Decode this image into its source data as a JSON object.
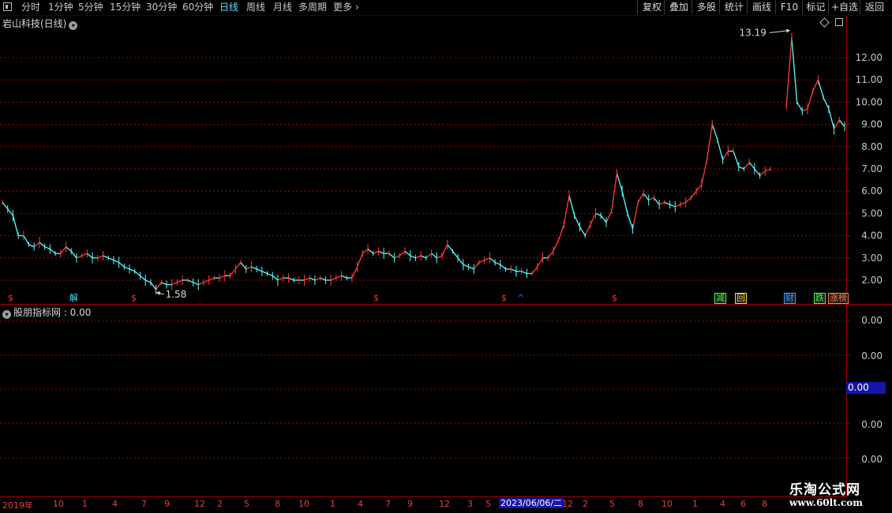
{
  "toolbar": {
    "tabs": [
      {
        "label": "分时",
        "active": false
      },
      {
        "label": "1分钟",
        "active": false
      },
      {
        "label": "5分钟",
        "active": false
      },
      {
        "label": "15分钟",
        "active": false
      },
      {
        "label": "30分钟",
        "active": false
      },
      {
        "label": "60分钟",
        "active": false
      },
      {
        "label": "日线",
        "active": true
      },
      {
        "label": "周线",
        "active": false
      },
      {
        "label": "月线",
        "active": false
      },
      {
        "label": "多周期",
        "active": false
      },
      {
        "label": "更多",
        "active": false
      }
    ],
    "more_arrow": "›",
    "right_buttons": [
      "复权",
      "叠加",
      "多股",
      "统计",
      "画线",
      "F10",
      "标记",
      "+自选",
      "返回"
    ]
  },
  "main_panel": {
    "title": "岩山科技(日线)"
  },
  "indicator_panel": {
    "title": "股朋指标网 : 0.00",
    "ticks": [
      "0.00",
      "0.00",
      "0.00",
      "0.00",
      "0.00"
    ],
    "current_value": "0.00"
  },
  "event_markers": [
    {
      "label": "$",
      "color": "#ff3030"
    },
    {
      "label": "解",
      "color": "#40e0ff"
    },
    {
      "label": "$",
      "color": "#ff3030"
    },
    {
      "label": "$",
      "color": "#ff3030"
    },
    {
      "label": "$",
      "color": "#ff3030"
    },
    {
      "label": "^",
      "color": "#4060ff"
    },
    {
      "label": "$",
      "color": "#ff3030"
    },
    {
      "label": "减",
      "color": "#40ff40"
    },
    {
      "label": "回",
      "color": "#ffd040"
    },
    {
      "label": "财",
      "color": "#40a0ff"
    },
    {
      "label": "跌",
      "color": "#40ff40"
    },
    {
      "label": "涨榜",
      "color": "#ff8040"
    }
  ],
  "x_axis": {
    "labels": [
      "2019年",
      "10",
      "1",
      "4",
      "7",
      "9",
      "12",
      "2",
      "5",
      "8",
      "10",
      "1",
      "4",
      "7",
      "9",
      "12",
      "3",
      "5",
      "12",
      "2",
      "5",
      "8",
      "10",
      "1",
      "4",
      "6",
      "8"
    ],
    "current_date": "2023/06/06/二"
  },
  "watermark": {
    "site_name": "乐淘公式网",
    "url": "www.60lt.com"
  },
  "colors": {
    "up": "#ff3c3c",
    "down": "#54ffff",
    "grid": "#aa0000",
    "axis_text": "#c8c8c8"
  },
  "chart_data": {
    "type": "line",
    "title": "岩山科技(日线)",
    "xlabel": "",
    "ylabel": "",
    "ylim": [
      1.3,
      13.5
    ],
    "y_ticks": [
      2.0,
      3.0,
      4.0,
      5.0,
      6.0,
      7.0,
      8.0,
      9.0,
      10.0,
      11.0,
      12.0
    ],
    "y_tick_labels": [
      "2.00",
      "3.00",
      "4.00",
      "5.00",
      "6.00",
      "7.00",
      "8.00",
      "9.00",
      "10.00",
      "11.00",
      "12.00"
    ],
    "annotations": [
      {
        "label": "13.19",
        "value": 13.19
      },
      {
        "label": "1.58",
        "value": 1.58
      }
    ],
    "series": [
      {
        "values": [
          5.5,
          5.2,
          4.9,
          4.0,
          4.0,
          3.6,
          3.5,
          3.7,
          3.5,
          3.4,
          3.2,
          3.2,
          3.5,
          3.3,
          3.0,
          3.1,
          3.2,
          3.0,
          3.0,
          3.1,
          3.0,
          2.9,
          2.8,
          2.6,
          2.5,
          2.4,
          2.2,
          2.0,
          1.9,
          1.58,
          1.9,
          1.8,
          1.8,
          1.9,
          2.0,
          2.0,
          1.9,
          1.8,
          1.9,
          2.0,
          2.1,
          2.1,
          2.2,
          2.2,
          2.5,
          2.8,
          2.5,
          2.6,
          2.5,
          2.4,
          2.3,
          2.2,
          2.0,
          2.1,
          2.1,
          2.0,
          2.0,
          2.0,
          2.1,
          2.0,
          2.1,
          2.0,
          2.0,
          2.1,
          2.2,
          2.1,
          2.1,
          2.6,
          3.2,
          3.4,
          3.2,
          3.3,
          3.2,
          3.2,
          3.0,
          3.1,
          3.3,
          3.1,
          3.0,
          3.1,
          3.0,
          3.2,
          3.0,
          3.1,
          3.6,
          3.3,
          3.0,
          2.7,
          2.6,
          2.5,
          2.8,
          2.9,
          3.0,
          2.8,
          2.7,
          2.5,
          2.5,
          2.4,
          2.4,
          2.3,
          2.3,
          2.6,
          3.0,
          3.0,
          3.3,
          3.8,
          4.5,
          5.8,
          4.9,
          4.4,
          4.0,
          4.5,
          5.0,
          4.9,
          4.6,
          5.1,
          6.8,
          6.0,
          5.0,
          4.3,
          5.5,
          5.9,
          5.6,
          5.7,
          5.4,
          5.5,
          5.4,
          5.3,
          5.4,
          5.5,
          5.7,
          6.0,
          6.3,
          7.4,
          9.0,
          8.3,
          7.4,
          7.8,
          7.8,
          7.1,
          7.0,
          7.3,
          7.0,
          6.7,
          6.9,
          7.0,
          null,
          null,
          9.8,
          12.9,
          10.0,
          9.6,
          9.7,
          10.5,
          11.0,
          10.2,
          9.7,
          8.8,
          9.2,
          8.9
        ]
      }
    ],
    "legend": "none",
    "grid": true
  }
}
